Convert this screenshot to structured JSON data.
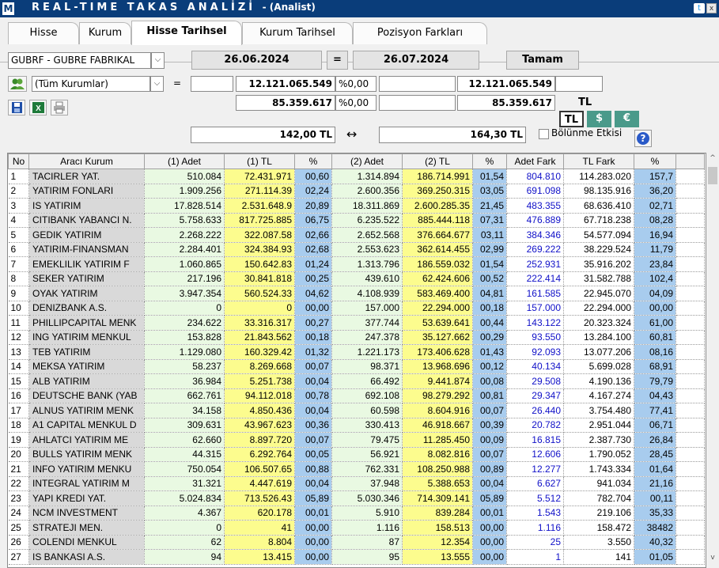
{
  "titlebar": {
    "logo": "M",
    "title": "REAL-TIME TAKAS ANALİZİ",
    "subtitle": "- (Analist)",
    "twitter": "t",
    "close": "x"
  },
  "tabs": [
    "Hisse",
    "Kurum",
    "Hisse Tarihsel",
    "Kurum Tarihsel",
    "Pozisyon Farkları"
  ],
  "active_tab": "Hisse Tarihsel",
  "controls": {
    "stock_select": "GUBRF - GUBRE FABRIKAL",
    "date_start": "26.06.2024",
    "equals_label": "=",
    "date_end": "26.07.2024",
    "ok_button": "Tamam",
    "broker_select": "(Tüm Kurumlar)",
    "eq2": "=",
    "row1": {
      "v1": "12.121.065.549",
      "p1": "%0,00",
      "v2": "12.121.065.549"
    },
    "row2": {
      "v1": "85.359.617",
      "p1": "%0,00",
      "v2": "85.359.617"
    },
    "tl_label": "TL",
    "currency_buttons": [
      "TL",
      "$",
      "€"
    ],
    "price_start": "142,00 TL",
    "arrow": "↔",
    "price_end": "164,30 TL",
    "split_label": "Bölünme Etkisi",
    "help": "?"
  },
  "colors": {
    "title_bg": "#0a3d7a",
    "green": "#e9f9e2",
    "yellow": "#fcfc8e",
    "blue": "#a8ccee",
    "fark_text": "#1010c8"
  },
  "table": {
    "headers": [
      "No",
      "Aracı Kurum",
      "(1) Adet",
      "(1) TL",
      "%",
      "(2) Adet",
      "(2) TL",
      "%",
      "Adet Fark",
      "TL Fark",
      "%"
    ],
    "rows": [
      [
        "1",
        "TACIRLER YAT.",
        "510.084",
        "72.431.971",
        "00,60",
        "1.314.894",
        "186.714.991",
        "01,54",
        "804.810",
        "114.283.020",
        "157,7"
      ],
      [
        "2",
        "YATIRIM FONLARI",
        "1.909.256",
        "271.114.39",
        "02,24",
        "2.600.356",
        "369.250.315",
        "03,05",
        "691.098",
        "98.135.916",
        "36,20"
      ],
      [
        "3",
        "IS YATIRIM",
        "17.828.514",
        "2.531.648.9",
        "20,89",
        "18.311.869",
        "2.600.285.35",
        "21,45",
        "483.355",
        "68.636.410",
        "02,71"
      ],
      [
        "4",
        "CITIBANK YABANCI N.",
        "5.758.633",
        "817.725.885",
        "06,75",
        "6.235.522",
        "885.444.118",
        "07,31",
        "476.889",
        "67.718.238",
        "08,28"
      ],
      [
        "5",
        "GEDIK YATIRIM",
        "2.268.222",
        "322.087.58",
        "02,66",
        "2.652.568",
        "376.664.677",
        "03,11",
        "384.346",
        "54.577.094",
        "16,94"
      ],
      [
        "6",
        "YATIRIM-FINANSMAN",
        "2.284.401",
        "324.384.93",
        "02,68",
        "2.553.623",
        "362.614.455",
        "02,99",
        "269.222",
        "38.229.524",
        "11,79"
      ],
      [
        "7",
        "EMEKLILIK YATIRIM F",
        "1.060.865",
        "150.642.83",
        "01,24",
        "1.313.796",
        "186.559.032",
        "01,54",
        "252.931",
        "35.916.202",
        "23,84"
      ],
      [
        "8",
        "SEKER YATIRIM",
        "217.196",
        "30.841.818",
        "00,25",
        "439.610",
        "62.424.606",
        "00,52",
        "222.414",
        "31.582.788",
        "102,4"
      ],
      [
        "9",
        "OYAK YATIRIM",
        "3.947.354",
        "560.524.33",
        "04,62",
        "4.108.939",
        "583.469.400",
        "04,81",
        "161.585",
        "22.945.070",
        "04,09"
      ],
      [
        "10",
        "DENIZBANK A.S.",
        "0",
        "0",
        "00,00",
        "157.000",
        "22.294.000",
        "00,18",
        "157.000",
        "22.294.000",
        "00,00"
      ],
      [
        "11",
        "PHILLIPCAPITAL MENK",
        "234.622",
        "33.316.317",
        "00,27",
        "377.744",
        "53.639.641",
        "00,44",
        "143.122",
        "20.323.324",
        "61,00"
      ],
      [
        "12",
        "ING YATIRIM MENKUL",
        "153.828",
        "21.843.562",
        "00,18",
        "247.378",
        "35.127.662",
        "00,29",
        "93.550",
        "13.284.100",
        "60,81"
      ],
      [
        "13",
        "TEB YATIRIM",
        "1.129.080",
        "160.329.42",
        "01,32",
        "1.221.173",
        "173.406.628",
        "01,43",
        "92.093",
        "13.077.206",
        "08,16"
      ],
      [
        "14",
        "MEKSA YATIRIM",
        "58.237",
        "8.269.668",
        "00,07",
        "98.371",
        "13.968.696",
        "00,12",
        "40.134",
        "5.699.028",
        "68,91"
      ],
      [
        "15",
        "ALB YATIRIM",
        "36.984",
        "5.251.738",
        "00,04",
        "66.492",
        "9.441.874",
        "00,08",
        "29.508",
        "4.190.136",
        "79,79"
      ],
      [
        "16",
        "DEUTSCHE BANK (YAB",
        "662.761",
        "94.112.018",
        "00,78",
        "692.108",
        "98.279.292",
        "00,81",
        "29.347",
        "4.167.274",
        "04,43"
      ],
      [
        "17",
        "ALNUS YATIRIM MENK",
        "34.158",
        "4.850.436",
        "00,04",
        "60.598",
        "8.604.916",
        "00,07",
        "26.440",
        "3.754.480",
        "77,41"
      ],
      [
        "18",
        "A1 CAPITAL MENKUL D",
        "309.631",
        "43.967.623",
        "00,36",
        "330.413",
        "46.918.667",
        "00,39",
        "20.782",
        "2.951.044",
        "06,71"
      ],
      [
        "19",
        "AHLATCI YATIRIM ME",
        "62.660",
        "8.897.720",
        "00,07",
        "79.475",
        "11.285.450",
        "00,09",
        "16.815",
        "2.387.730",
        "26,84"
      ],
      [
        "20",
        "BULLS YATIRIM MENK",
        "44.315",
        "6.292.764",
        "00,05",
        "56.921",
        "8.082.816",
        "00,07",
        "12.606",
        "1.790.052",
        "28,45"
      ],
      [
        "21",
        "INFO YATIRIM MENKU",
        "750.054",
        "106.507.65",
        "00,88",
        "762.331",
        "108.250.988",
        "00,89",
        "12.277",
        "1.743.334",
        "01,64"
      ],
      [
        "22",
        "INTEGRAL YATIRIM M",
        "31.321",
        "4.447.619",
        "00,04",
        "37.948",
        "5.388.653",
        "00,04",
        "6.627",
        "941.034",
        "21,16"
      ],
      [
        "23",
        "YAPI KREDI YAT.",
        "5.024.834",
        "713.526.43",
        "05,89",
        "5.030.346",
        "714.309.141",
        "05,89",
        "5.512",
        "782.704",
        "00,11"
      ],
      [
        "24",
        "NCM INVESTMENT",
        "4.367",
        "620.178",
        "00,01",
        "5.910",
        "839.284",
        "00,01",
        "1.543",
        "219.106",
        "35,33"
      ],
      [
        "25",
        "STRATEJI MEN.",
        "0",
        "41",
        "00,00",
        "1.116",
        "158.513",
        "00,00",
        "1.116",
        "158.472",
        "38482"
      ],
      [
        "26",
        "COLENDI MENKUL",
        "62",
        "8.804",
        "00,00",
        "87",
        "12.354",
        "00,00",
        "25",
        "3.550",
        "40,32"
      ],
      [
        "27",
        "IS BANKASI A.S.",
        "94",
        "13.415",
        "00,00",
        "95",
        "13.555",
        "00,00",
        "1",
        "141",
        "01,05"
      ]
    ]
  }
}
